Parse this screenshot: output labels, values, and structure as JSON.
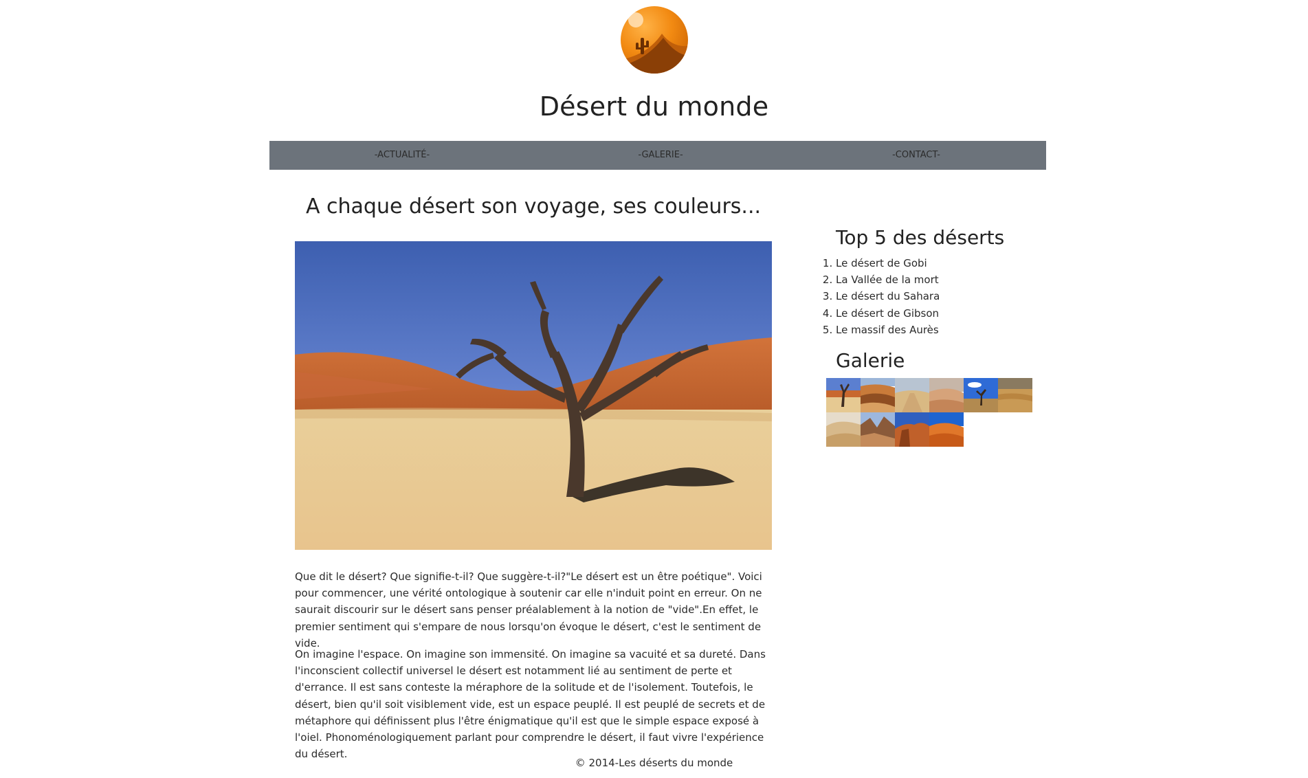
{
  "site": {
    "title": "Désert du monde",
    "logo_icon": "desert-cactus-logo"
  },
  "nav": {
    "items": [
      {
        "label": "-ACTUALITÉ-"
      },
      {
        "label": "-GALERIE-"
      },
      {
        "label": "-CONTACT-"
      }
    ]
  },
  "main": {
    "heading": "A chaque désert son voyage, ses couleurs...",
    "hero_icon": "dead-tree-desert-photo",
    "paragraphs": [
      "Que dit le désert? Que signifie-t-il? Que suggère-t-il?\"Le désert est un être poétique\". Voici pour commencer, une vérité ontologique à soutenir car elle n'induit point en erreur. On ne saurait discourir sur le désert sans penser préalablement à la notion de \"vide\".En effet, le premier sentiment qui s'empare de nous lorsqu'on évoque le désert, c'est le sentiment de vide.",
      "On imagine l'espace. On imagine son immensité. On imagine sa vacuité et sa dureté. Dans l'inconscient collectif universel le désert est notamment lié au sentiment de perte et d'errance. Il est sans conteste la méraphore de la solitude et de l'isolement. Toutefois, le désert, bien qu'il soit visiblement vide, est un espace peuplé. Il est peuplé de secrets et de métaphore qui définissent plus l'être énigmatique qu'il est que le simple espace exposé à l'oiel. Phonoménologiquement parlant pour comprendre le désert, il faut vivre l'expérience du désert."
    ]
  },
  "sidebar": {
    "top_heading": "Top 5 des déserts",
    "top_list": [
      "Le désert de Gobi",
      "La Vallée de la mort",
      "Le désert du Sahara",
      "Le désert de Gibson",
      "Le massif des Aurès"
    ],
    "gallery_heading": "Galerie",
    "gallery_icons": [
      "dead-tree-thumb",
      "dunes-thumb",
      "sand-road-thumb",
      "sand-plain-thumb",
      "blue-sky-tree-thumb",
      "rocky-desert-thumb",
      "pale-dunes-thumb",
      "rock-formation-thumb",
      "red-rock-thumb",
      "orange-dunes-thumb"
    ]
  },
  "footer": {
    "text": "© 2014-Les déserts du monde"
  },
  "colors": {
    "nav_bg": "#6c737b",
    "logo_orange": "#f08a14",
    "text": "#222222"
  }
}
